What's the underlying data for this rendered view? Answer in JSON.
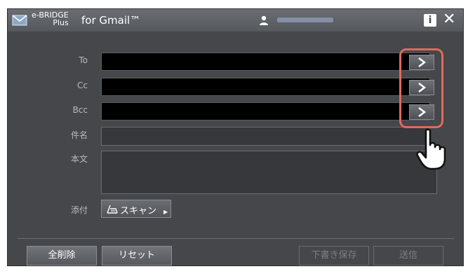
{
  "titlebar": {
    "brand_top": "e-BRIDGE",
    "brand_bottom": "Plus",
    "title": "for Gmail™"
  },
  "form": {
    "to_label": "To",
    "cc_label": "Cc",
    "bcc_label": "Bcc",
    "subject_label": "件名",
    "body_label": "本文",
    "attach_label": "添付",
    "to_value": "",
    "cc_value": "",
    "bcc_value": "",
    "subject_value": "",
    "body_value": "",
    "scan_label": "スキャン"
  },
  "footer": {
    "clear_all": "全削除",
    "reset": "リセット",
    "save_draft": "下書き保存",
    "send": "送信"
  },
  "colors": {
    "highlight": "#e06a5c",
    "background": "#45474a"
  },
  "icons": [
    "mail-icon",
    "user-icon",
    "info-icon",
    "close-icon",
    "chevron-right-icon",
    "scanner-icon",
    "hand-pointer-icon"
  ]
}
